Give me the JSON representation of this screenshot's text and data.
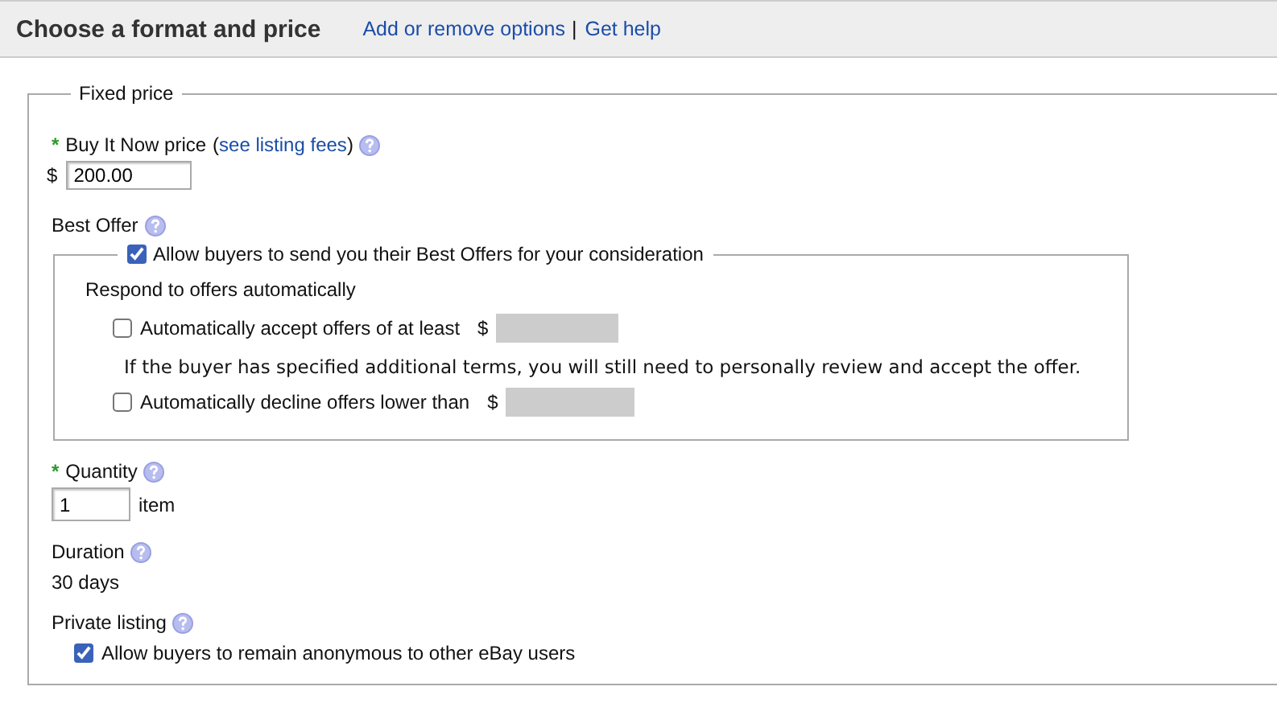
{
  "header": {
    "title": "Choose a format and price",
    "links": [
      {
        "label": "Add or remove options"
      },
      {
        "label": "Get help"
      }
    ],
    "separator": "|"
  },
  "fixed_price": {
    "legend": "Fixed price",
    "price": {
      "marker": "*",
      "label": "Buy It Now price",
      "open": "(",
      "link": "see listing fees",
      "close": ")",
      "help": true,
      "currency": "$",
      "value": "200.00"
    },
    "best_offer": {
      "label": "Best Offer",
      "help": true,
      "allow": {
        "label": "Allow buyers to send you their Best Offers for your consideration",
        "checked": true
      },
      "respond_label": "Respond to offers automatically",
      "options": [
        {
          "label": "Automatically accept offers of at least",
          "checked": false,
          "currency": "$",
          "note": "If the buyer has specified additional terms, you will still need to personally review and accept the offer."
        },
        {
          "label": "Automatically decline offers lower than",
          "checked": false,
          "currency": "$"
        }
      ]
    },
    "quantity": {
      "marker": "*",
      "label": "Quantity",
      "help": true,
      "value": "1",
      "unit": "item"
    },
    "duration": {
      "label": "Duration",
      "help": true,
      "value": "30 days"
    },
    "private_listing": {
      "label": "Private listing",
      "help": true,
      "option": {
        "label": "Allow buyers to remain anonymous to other eBay users",
        "checked": true
      }
    }
  }
}
